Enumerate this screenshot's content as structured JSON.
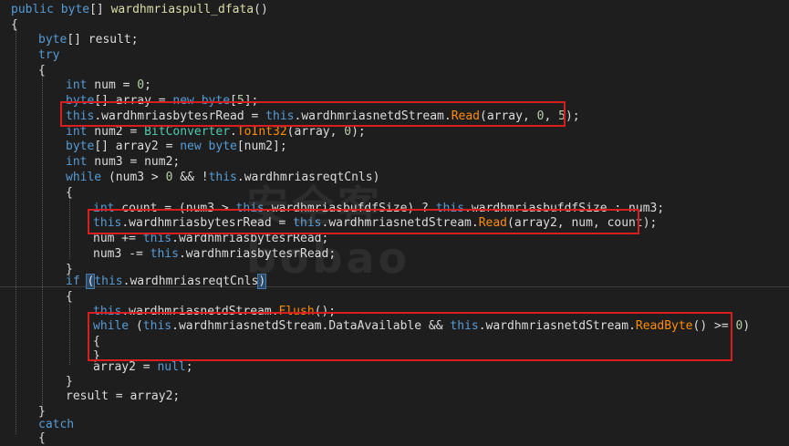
{
  "theme": {
    "background": "#1e1e1e",
    "highlight_box_color": "#d81e1e",
    "keyword_color": "#569cd6",
    "method_color": "#ff8c00",
    "type_color": "#4ec9b0"
  },
  "code": {
    "lines": [
      [
        [
          "kw",
          "public"
        ],
        [
          "pn",
          " "
        ],
        [
          "kw",
          "byte"
        ],
        [
          "pn",
          "[] "
        ],
        [
          "fn",
          "wardhmriaspull_dfata"
        ],
        [
          "pn",
          "()"
        ]
      ],
      [
        [
          "pn",
          "{"
        ]
      ],
      [
        [
          "kw",
          "byte"
        ],
        [
          "pn",
          "[] result;"
        ]
      ],
      [
        [
          "kw",
          "try"
        ]
      ],
      [
        [
          "pn",
          "{"
        ]
      ],
      [
        [
          "kw",
          "int"
        ],
        [
          "pn",
          " num = "
        ],
        [
          "nm",
          "0"
        ],
        [
          "pn",
          ";"
        ]
      ],
      [
        [
          "kw",
          "byte"
        ],
        [
          "pn",
          "[] array = "
        ],
        [
          "kw",
          "new"
        ],
        [
          "pn",
          " "
        ],
        [
          "kw",
          "byte"
        ],
        [
          "pn",
          "["
        ],
        [
          "nm",
          "5"
        ],
        [
          "pn",
          "];"
        ]
      ],
      [
        [
          "kw",
          "this"
        ],
        [
          "pn",
          "."
        ],
        [
          "prop",
          "wardhmriasbytesrRead"
        ],
        [
          "pn",
          " = "
        ],
        [
          "kw",
          "this"
        ],
        [
          "pn",
          "."
        ],
        [
          "prop",
          "wardhmriasnetdStream"
        ],
        [
          "pn",
          "."
        ],
        [
          "meth",
          "Read"
        ],
        [
          "pn",
          "(array, "
        ],
        [
          "nm",
          "0"
        ],
        [
          "pn",
          ", "
        ],
        [
          "nm",
          "5"
        ],
        [
          "pn",
          ");"
        ]
      ],
      [
        [
          "kw",
          "int"
        ],
        [
          "pn",
          " num2 = "
        ],
        [
          "ty",
          "BitConverter"
        ],
        [
          "pn",
          "."
        ],
        [
          "meth",
          "ToInt32"
        ],
        [
          "pn",
          "(array, "
        ],
        [
          "nm",
          "0"
        ],
        [
          "pn",
          ");"
        ]
      ],
      [
        [
          "kw",
          "byte"
        ],
        [
          "pn",
          "[] array2 = "
        ],
        [
          "kw",
          "new"
        ],
        [
          "pn",
          " "
        ],
        [
          "kw",
          "byte"
        ],
        [
          "pn",
          "[num2];"
        ]
      ],
      [
        [
          "kw",
          "int"
        ],
        [
          "pn",
          " num3 = num2;"
        ]
      ],
      [
        [
          "kw",
          "while"
        ],
        [
          "pn",
          " (num3 > "
        ],
        [
          "nm",
          "0"
        ],
        [
          "pn",
          " && !"
        ],
        [
          "kw",
          "this"
        ],
        [
          "pn",
          "."
        ],
        [
          "prop",
          "wardhmriasreqtCnls"
        ],
        [
          "pn",
          ")"
        ]
      ],
      [
        [
          "pn",
          "{"
        ]
      ],
      [
        [
          "kw",
          "int"
        ],
        [
          "pn",
          " count = (num3 > "
        ],
        [
          "kw",
          "this"
        ],
        [
          "pn",
          "."
        ],
        [
          "prop",
          "wardhmriasbufdfSize"
        ],
        [
          "pn",
          ") ? "
        ],
        [
          "kw",
          "this"
        ],
        [
          "pn",
          "."
        ],
        [
          "prop",
          "wardhmriasbufdfSize"
        ],
        [
          "pn",
          " : num3;"
        ]
      ],
      [
        [
          "kw",
          "this"
        ],
        [
          "pn",
          "."
        ],
        [
          "prop",
          "wardhmriasbytesrRead"
        ],
        [
          "pn",
          " = "
        ],
        [
          "kw",
          "this"
        ],
        [
          "pn",
          "."
        ],
        [
          "prop",
          "wardhmriasnetdStream"
        ],
        [
          "pn",
          "."
        ],
        [
          "meth",
          "Read"
        ],
        [
          "pn",
          "(array2, num, count);"
        ]
      ],
      [
        [
          "pn",
          "num += "
        ],
        [
          "kw",
          "this"
        ],
        [
          "pn",
          "."
        ],
        [
          "prop",
          "wardhmriasbytesrRead"
        ],
        [
          "pn",
          ";"
        ]
      ],
      [
        [
          "pn",
          "num3 -= "
        ],
        [
          "kw",
          "this"
        ],
        [
          "pn",
          "."
        ],
        [
          "prop",
          "wardhmriasbytesrRead"
        ],
        [
          "pn",
          ";"
        ]
      ],
      [
        [
          "pn",
          "}"
        ]
      ],
      [
        [
          "kw",
          "if"
        ],
        [
          "pn",
          " "
        ],
        [
          "mb",
          "("
        ],
        [
          "kw",
          "this"
        ],
        [
          "pn",
          "."
        ],
        [
          "prop",
          "wardhmriasreqtCnls"
        ],
        [
          "mb",
          ")"
        ]
      ],
      [
        [
          "pn",
          "{"
        ]
      ],
      [
        [
          "kw",
          "this"
        ],
        [
          "pn",
          "."
        ],
        [
          "prop",
          "wardhmriasnetdStream"
        ],
        [
          "pn",
          "."
        ],
        [
          "meth",
          "Flush"
        ],
        [
          "pn",
          "();"
        ]
      ],
      [
        [
          "kw",
          "while"
        ],
        [
          "pn",
          " ("
        ],
        [
          "kw",
          "this"
        ],
        [
          "pn",
          "."
        ],
        [
          "prop",
          "wardhmriasnetdStream"
        ],
        [
          "pn",
          "."
        ],
        [
          "prop",
          "DataAvailable"
        ],
        [
          "pn",
          " && "
        ],
        [
          "kw",
          "this"
        ],
        [
          "pn",
          "."
        ],
        [
          "prop",
          "wardhmriasnetdStream"
        ],
        [
          "pn",
          "."
        ],
        [
          "meth",
          "ReadByte"
        ],
        [
          "pn",
          "() >= "
        ],
        [
          "nm",
          "0"
        ],
        [
          "pn",
          ")"
        ]
      ],
      [
        [
          "pn",
          "{"
        ]
      ],
      [
        [
          "pn",
          "}"
        ]
      ],
      [
        [
          "pn",
          "array2 = "
        ],
        [
          "kw",
          "null"
        ],
        [
          "pn",
          ";"
        ]
      ],
      [
        [
          "pn",
          "}"
        ]
      ],
      [
        [
          "pn",
          "result = array2;"
        ]
      ],
      [
        [
          "pn",
          "}"
        ]
      ],
      [
        [
          "kw",
          "catch"
        ]
      ],
      [
        [
          "pn",
          "{"
        ]
      ]
    ]
  },
  "watermark": {
    "text": "安全客 bobao"
  }
}
